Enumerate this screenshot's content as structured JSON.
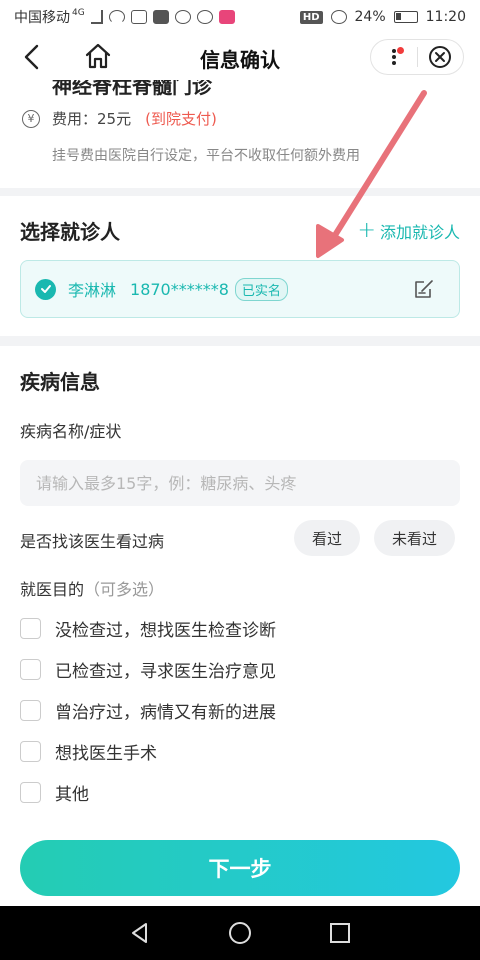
{
  "status_bar": {
    "carrier": "中国移动",
    "network": "4G",
    "battery": "24%",
    "time": "11:20",
    "hd": "HD"
  },
  "nav": {
    "title": "信息确认"
  },
  "appointment": {
    "department": "神经脊柱脊髓门诊",
    "fee_icon": "¥",
    "fee_label": "费用：25元",
    "payment": "(到院支付)",
    "note": "挂号费由医院自行设定，平台不收取任何额外费用"
  },
  "patient_section": {
    "title": "选择就诊人",
    "add_label": "添加就诊人",
    "patient": {
      "name": "李淋淋",
      "phone": "1870******8",
      "badge": "已实名"
    }
  },
  "disease_section": {
    "title": "疾病信息",
    "symptom_label": "疾病名称/症状",
    "symptom_placeholder": "请输入最多15字，例：糖尿病、头疼",
    "seen_doctor_label": "是否找该医生看过病",
    "seen_options": [
      "看过",
      "未看过"
    ],
    "purpose_label": "就医目的",
    "purpose_hint": "（可多选）",
    "purposes": [
      "没检查过，想找医生检查诊断",
      "已检查过，寻求医生治疗意见",
      "曾治疗过，病情又有新的进展",
      "想找医生手术",
      "其他"
    ]
  },
  "footer": {
    "next_label": "下一步"
  },
  "colors": {
    "accent": "#1ab8b0",
    "pay_red": "#ee5a4f",
    "annotation_arrow": "#e8727a"
  }
}
